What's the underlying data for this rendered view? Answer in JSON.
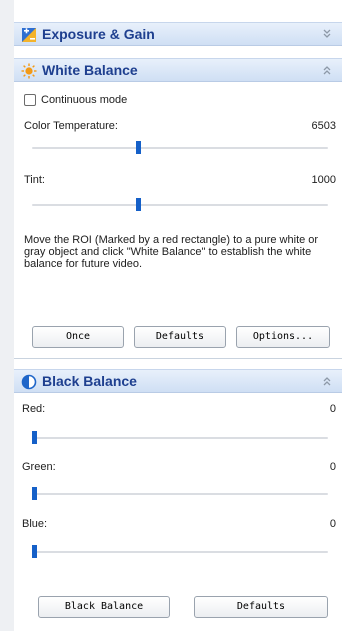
{
  "colors": {
    "header_title": "#1e3f8f",
    "slider_thumb": "#1560c8",
    "header_bg": "#cfdff4"
  },
  "exposure_gain": {
    "title": "Exposure & Gain",
    "icon": "exposure-icon",
    "collapse_icon": "double-chevron-down-icon"
  },
  "white_balance": {
    "title": "White Balance",
    "icon": "sun-icon",
    "collapse_icon": "double-chevron-up-icon",
    "continuous_mode_label": "Continuous mode",
    "continuous_mode_checked": false,
    "color_temperature": {
      "label": "Color Temperature:",
      "value": "6503",
      "slider_fraction": 0.35
    },
    "tint": {
      "label": "Tint:",
      "value": "1000",
      "slider_fraction": 0.35
    },
    "description": "Move the ROI (Marked by a red rectangle) to a pure white or gray object and click \"White Balance\" to establish the white balance for future video.",
    "buttons": {
      "once": "Once",
      "defaults": "Defaults",
      "options": "Options..."
    }
  },
  "black_balance": {
    "title": "Black Balance",
    "icon": "contrast-circle-icon",
    "collapse_icon": "double-chevron-up-icon",
    "red": {
      "label": "Red:",
      "value": "0",
      "slider_fraction": 0.0
    },
    "green": {
      "label": "Green:",
      "value": "0",
      "slider_fraction": 0.0
    },
    "blue": {
      "label": "Blue:",
      "value": "0",
      "slider_fraction": 0.0
    },
    "buttons": {
      "black_balance": "Black Balance",
      "defaults": "Defaults"
    }
  }
}
